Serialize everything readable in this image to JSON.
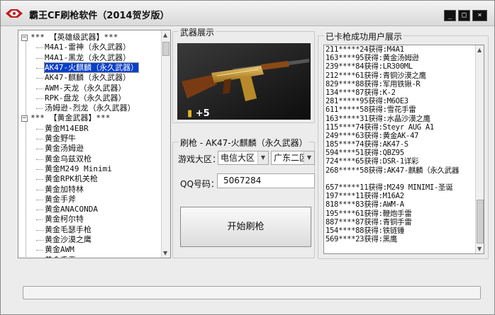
{
  "window": {
    "title": "霸王CF刷枪软件（2014贺岁版）",
    "buttons": {
      "minimize": "_",
      "maximize": "□",
      "close": "×"
    }
  },
  "tree": {
    "categories": [
      {
        "label": "*** 【英雄级武器】***",
        "items": [
          "M4A1-雷神（永久武器）",
          "M4A1-黑龙（永久武器）",
          "AK47-火麒麟（永久武器）",
          "AK47-麒麟（永久武器）",
          "AWM-天龙（永久武器）",
          "RPK-盘龙（永久武器）",
          "汤姆逊-烈龙（永久武器）"
        ]
      },
      {
        "label": "*** 【黄金武器】***",
        "items": [
          "黄金M14EBR",
          "黄金野牛",
          "黄金汤姆逊",
          "黄金乌兹双枪",
          "黄金M249 Minimi",
          "黄金RPK机关枪",
          "黄金加特林",
          "黄金手斧",
          "黄金ANACONDA",
          "黄金柯尔特",
          "黄金毛瑟手枪",
          "黄金沙漠之鹰",
          "黄金AWM",
          "黄金手雷"
        ]
      }
    ],
    "selected_item": "AK47-火麒麟（永久武器）"
  },
  "weapon_display": {
    "title": "武器展示",
    "plus_label": "+5"
  },
  "brush": {
    "title": "刷枪 - AK47-火麒麟（永久武器）",
    "region_label": "游戏大区：",
    "region_value": "电信大区",
    "server_value": "广东二区",
    "qq_label": "QQ号码：",
    "qq_value": "5067284",
    "start_button": "开始刷枪"
  },
  "log": {
    "title": "已卡枪成功用户展示",
    "lines": [
      "211*****24获得:M4A1",
      "163****95获得:黄金汤姆逊",
      "239****84获得:LR300ML",
      "212****61获得:青铜沙漠之鹰",
      "829****88获得:军用铁锹-R",
      "134****87获得:K-2",
      "281*****95获得:M6OE3",
      "611*****58获得:雪花手雷",
      "163*****31获得:水晶沙漠之鹰",
      "115****74获得:Steyr AUG A1",
      "249****63获得:黄金AK-47",
      "185****74获得:AK47-S",
      "594****51获得:QBZ95",
      "724****65获得:DSR-1详彩",
      "268*****58获得:AK47-麒麟（永久武器",
      "",
      "657*****11获得:M249 MINIMI-圣诞",
      "197****11获得:M16A2",
      "818****83获得:AWM-A",
      "195****61获得:鞭炮手雷",
      "887****87获得:青铜手雷",
      "154****88获得:铁链锤",
      "569****23获得:黑鹰"
    ]
  },
  "progress": {
    "value": 0
  },
  "colors": {
    "selection": "#0a3fc8",
    "window_bg": "#ececec",
    "progress_fill": "#3bb34a"
  }
}
